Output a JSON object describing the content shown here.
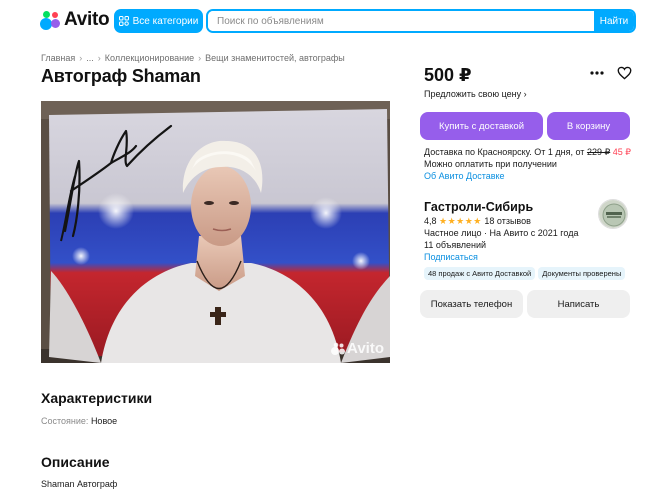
{
  "header": {
    "logo_text": "Avito",
    "categories_label": "Все категории",
    "search_placeholder": "Поиск по объявлениям",
    "search_button": "Найти"
  },
  "breadcrumbs": [
    "Главная",
    "...",
    "Коллекционирование",
    "Вещи знаменитостей, автографы"
  ],
  "item": {
    "title": "Автограф Shaman",
    "price": "500 ₽",
    "offer_price": "Предложить свою цену",
    "photo_watermark": "Avito"
  },
  "actions": {
    "buy_delivery": "Купить с доставкой",
    "to_cart": "В корзину",
    "show_phone": "Показать телефон",
    "write": "Написать"
  },
  "delivery": {
    "line1_prefix": "Доставка по Красноярску. От 1 дня, от",
    "old_price": "229 ₽",
    "new_price": "45 ₽",
    "line2": "Можно оплатить при получении",
    "link": "Об Авито Доставке"
  },
  "seller": {
    "name": "Гастроли-Сибирь",
    "rating": "4,8",
    "stars": "★★★★★",
    "reviews": "18 отзывов",
    "type": "Частное лицо · На Авито с 2021 года",
    "listings": "11 объявлений",
    "subscribe": "Подписаться",
    "badges": [
      "48 продаж с Авито Доставкой",
      "Документы проверены"
    ]
  },
  "characteristics": {
    "heading": "Характеристики",
    "condition_label": "Состояние:",
    "condition_value": "Новое"
  },
  "description": {
    "heading": "Описание",
    "text": "Shaman Автограф"
  },
  "colors": {
    "accent_blue": "#00aaff",
    "purple": "#965eeb",
    "link": "#0a8fe0",
    "discount": "#ff4053"
  }
}
